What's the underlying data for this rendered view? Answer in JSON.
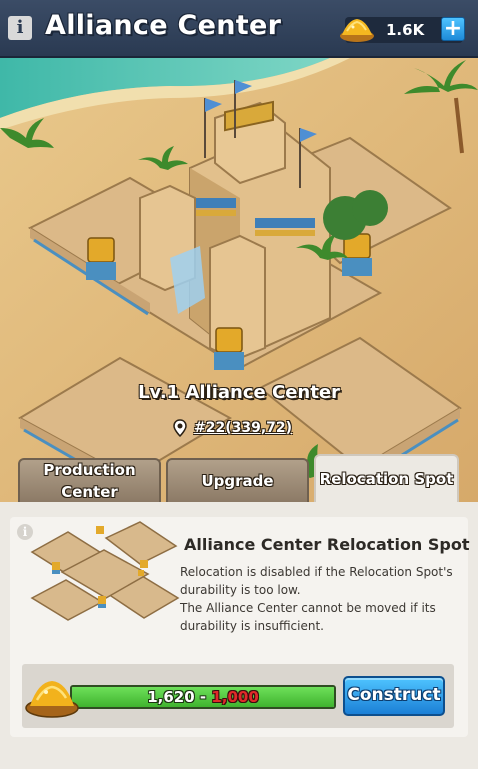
{
  "header": {
    "title": "Alliance Center",
    "resource": {
      "icon": "gold-pile-icon",
      "value": "1.6K"
    }
  },
  "scene": {
    "building_label": "Lv.1 Alliance Center",
    "coordinates": "#22(339,72)"
  },
  "tabs": [
    {
      "label": "Production Center",
      "active": false
    },
    {
      "label": "Upgrade",
      "active": false
    },
    {
      "label": "Relocation Spot",
      "active": true
    }
  ],
  "panel": {
    "title": "Alliance Center Relocation Spot",
    "description_lines": [
      "Relocation is disabled if the Relocation Spot's durability is too low.",
      "The Alliance Center cannot be moved if its durability is insufficient."
    ],
    "cost": {
      "current": "1,620",
      "separator": " - ",
      "required": "1,000",
      "progress_fraction": 1.0
    },
    "construct_label": "Construct"
  },
  "colors": {
    "header": "#2f3f58",
    "sand": "#e0b878",
    "construct_button": "#2a96e8",
    "progress_fill": "#4fc33c",
    "required_text": "#e02a2a"
  }
}
